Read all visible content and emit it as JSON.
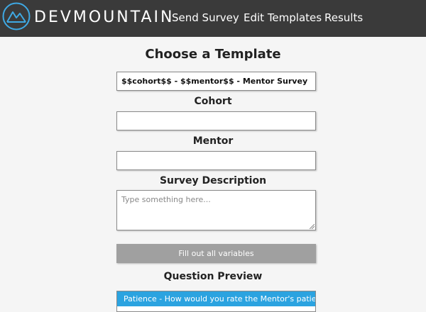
{
  "header": {
    "brand": "DEVMOUNTAIN",
    "logo_icon": "mountain-logo-icon",
    "nav": {
      "send_survey": "Send Survey",
      "edit_templates": "Edit Templates",
      "results": "Results"
    },
    "background_color": "#3a3a3a"
  },
  "main": {
    "title": "Choose a Template",
    "template_select_value": "$$cohort$$ - $$mentor$$ - Mentor Survey",
    "cohort": {
      "label": "Cohort",
      "value": ""
    },
    "mentor": {
      "label": "Mentor",
      "value": ""
    },
    "description": {
      "label": "Survey Description",
      "placeholder": "Type something here..."
    },
    "submit_button": {
      "label": "Fill out all variables",
      "color": "#a0a0a0"
    },
    "preview": {
      "label": "Question Preview",
      "question_header": "Patience - How would you rate the Mentor's patience?",
      "accent_color": "#2ba3e0"
    }
  }
}
